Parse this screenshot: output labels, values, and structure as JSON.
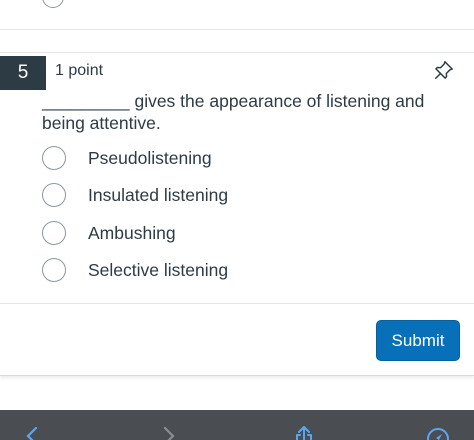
{
  "question": {
    "number": "5",
    "points": "1 point",
    "text": "_________ gives the appearance of listening and being attentive.",
    "answers": [
      "Pseudolistening",
      "Insulated listening",
      "Ambushing",
      "Selective listening"
    ]
  },
  "footer": {
    "submit_label": "Submit"
  },
  "toolbar": {
    "icons": [
      "back-icon",
      "forward-icon",
      "share-icon",
      "compass-icon"
    ]
  },
  "colors": {
    "accent": "#0770b8",
    "number_bg": "#2d3b45",
    "toolbar_bg": "#4a4d52"
  }
}
